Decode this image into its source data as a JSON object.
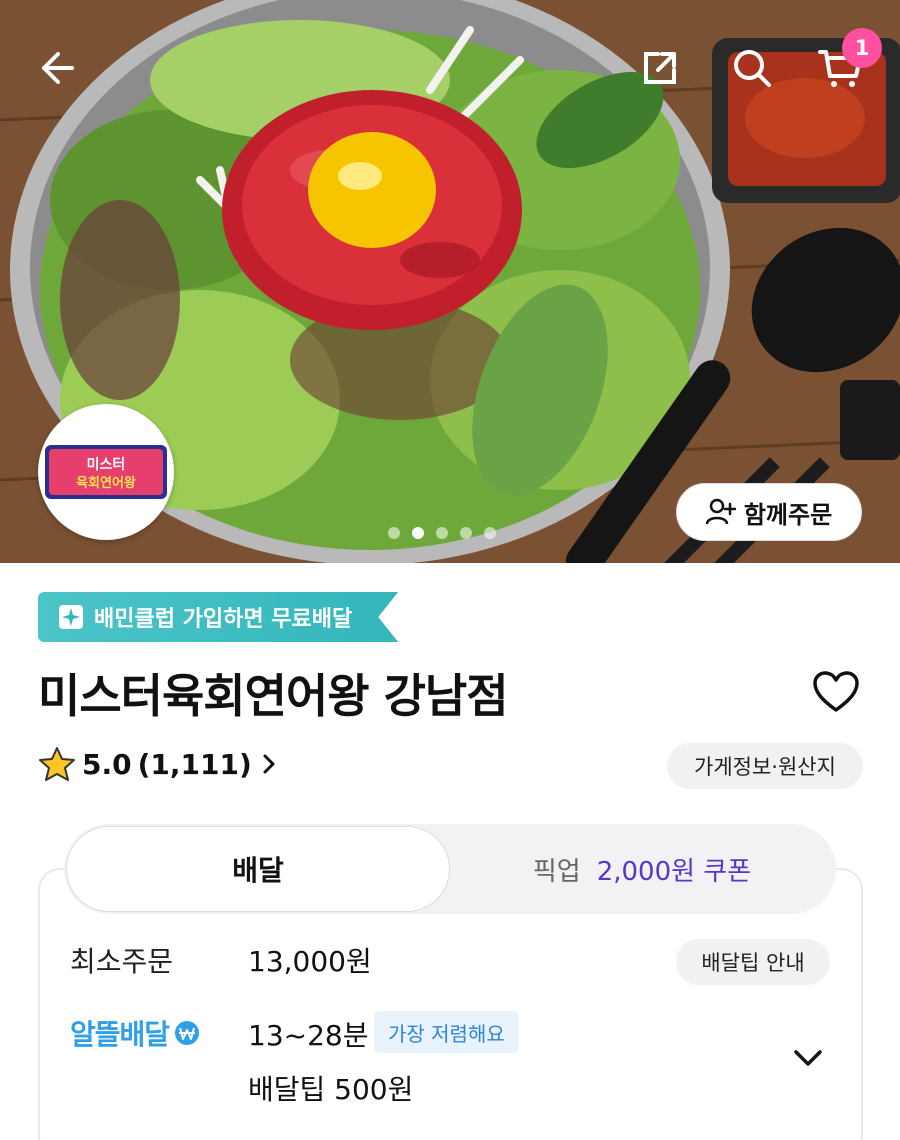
{
  "header": {
    "cart_count": "1",
    "group_order_label": "함께주문",
    "logo_text": [
      "미스터",
      "육회연어왕"
    ]
  },
  "carousel": {
    "total": 5,
    "active_index": 1
  },
  "store": {
    "club_banner": "배민클럽 가입하면 무료배달",
    "name": "미스터육회연어왕 강남점",
    "rating": "5.0",
    "review_count": "(1,111)",
    "info_button": "가게정보·원산지"
  },
  "tabs": {
    "delivery": "배달",
    "pickup": "픽업",
    "pickup_coupon": "2,000원 쿠폰"
  },
  "delivery": {
    "min_order_label": "최소주문",
    "min_order_value": "13,000원",
    "tip_info_button": "배달팁 안내",
    "service_name": "알뜰배달",
    "time": "13~28분",
    "cheapest_badge": "가장 저렴해요",
    "fee": "배달팁 500원"
  },
  "colors": {
    "badge_pink": "#ff4fa1",
    "club_teal": "#33b7bc",
    "coupon_purple": "#5a35c8",
    "alttl_blue": "#2f9fe8"
  },
  "icons": [
    "back-arrow-icon",
    "share-icon",
    "search-icon",
    "cart-icon",
    "add-user-icon",
    "heart-icon",
    "star-icon",
    "chevron-right-icon",
    "chevron-down-icon",
    "sparkle-icon",
    "won-coin-icon"
  ]
}
